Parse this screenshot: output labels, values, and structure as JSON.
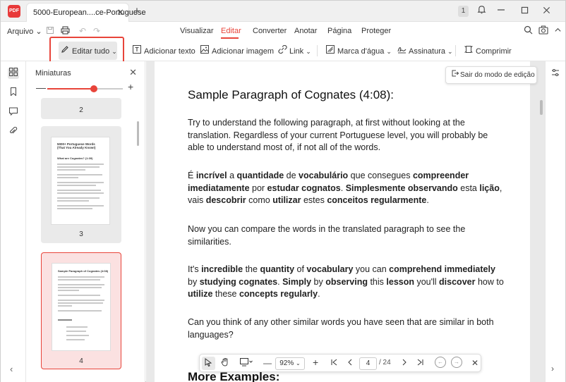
{
  "titlebar": {
    "app_logo": "PDF",
    "tab_label": "5000-European....ce-Portuguese",
    "tab_close": "✕",
    "new_tab": "+",
    "tab_count": "1",
    "icons": {
      "bell": "bell-icon",
      "minimize": "minimize-icon",
      "maximize": "maximize-icon",
      "close": "close-icon"
    }
  },
  "menubar": {
    "arquivo": "Arquivo",
    "tabs": [
      "Visualizar",
      "Editar",
      "Converter",
      "Anotar",
      "Página",
      "Proteger"
    ],
    "active_tab": "Editar"
  },
  "toolbar": {
    "edit_all": "Editar tudo",
    "add_text": "Adicionar texto",
    "add_image": "Adicionar imagem",
    "link": "Link",
    "watermark": "Marca d'água",
    "signature": "Assinatura",
    "compress": "Comprimir"
  },
  "panel": {
    "title": "Miniaturas",
    "zoom_level": 0.62,
    "thumbnails": [
      {
        "number": "2"
      },
      {
        "number": "3",
        "title_line1": "5000+ Portuguese Words",
        "title_line2": "(That You Already Know!)",
        "subheading": "What are Cognates? (1:39)"
      },
      {
        "number": "4",
        "title_line1": "Sample Paragraph of Cognates (4:08)"
      }
    ],
    "selected_page": "4"
  },
  "exit_edit": "Sair do modo de edição",
  "document": {
    "heading": "Sample Paragraph of Cognates (4:08):",
    "p1": "Try to understand the following paragraph, at first without looking at the translation. Regardless of your current Portuguese level, you will probably be able to understand most of, if not all of the words.",
    "p2": [
      {
        "t": "É ",
        "b": false
      },
      {
        "t": "incrível",
        "b": true
      },
      {
        "t": " a ",
        "b": false
      },
      {
        "t": "quantidade",
        "b": true
      },
      {
        "t": " de ",
        "b": false
      },
      {
        "t": "vocabulário",
        "b": true
      },
      {
        "t": " que consegues ",
        "b": false
      },
      {
        "t": "compreender",
        "b": true
      },
      {
        "t": " ",
        "b": false
      },
      {
        "t": "imediatamente",
        "b": true
      },
      {
        "t": " por ",
        "b": false
      },
      {
        "t": "estudar cognatos",
        "b": true
      },
      {
        "t": ". ",
        "b": false
      },
      {
        "t": "Simplesmente observando",
        "b": true
      },
      {
        "t": " esta ",
        "b": false
      },
      {
        "t": "lição",
        "b": true
      },
      {
        "t": ", vais ",
        "b": false
      },
      {
        "t": "descobrir",
        "b": true
      },
      {
        "t": " como ",
        "b": false
      },
      {
        "t": "utilizar",
        "b": true
      },
      {
        "t": " estes ",
        "b": false
      },
      {
        "t": "conceitos regularmente",
        "b": true
      },
      {
        "t": ".",
        "b": false
      }
    ],
    "p3": "Now you can compare the words in the translated paragraph to see the similarities.",
    "p4": [
      {
        "t": "It's ",
        "b": false
      },
      {
        "t": "incredible",
        "b": true
      },
      {
        "t": " the ",
        "b": false
      },
      {
        "t": "quantity",
        "b": true
      },
      {
        "t": " of ",
        "b": false
      },
      {
        "t": "vocabulary",
        "b": true
      },
      {
        "t": " you can ",
        "b": false
      },
      {
        "t": "comprehend immediately",
        "b": true
      },
      {
        "t": " by ",
        "b": false
      },
      {
        "t": "studying cognates",
        "b": true
      },
      {
        "t": ". ",
        "b": false
      },
      {
        "t": "Simply",
        "b": true
      },
      {
        "t": " by ",
        "b": false
      },
      {
        "t": "observing",
        "b": true
      },
      {
        "t": " this ",
        "b": false
      },
      {
        "t": "lesson",
        "b": true
      },
      {
        "t": " you'll ",
        "b": false
      },
      {
        "t": "discover",
        "b": true
      },
      {
        "t": " how to ",
        "b": false
      },
      {
        "t": "utilize",
        "b": true
      },
      {
        "t": " these ",
        "b": false
      },
      {
        "t": "concepts regularly",
        "b": true
      },
      {
        "t": ".",
        "b": false
      }
    ],
    "p5": "Can you think of any other similar words you have seen that are similar in both languages?",
    "next_heading": "More Examples:"
  },
  "pagebar": {
    "zoom": "92%",
    "current_page": "4",
    "total": "/ 24",
    "close": "✕"
  },
  "colors": {
    "accent": "#e8443a",
    "selected_thumb_bg": "#fbe1e1"
  }
}
